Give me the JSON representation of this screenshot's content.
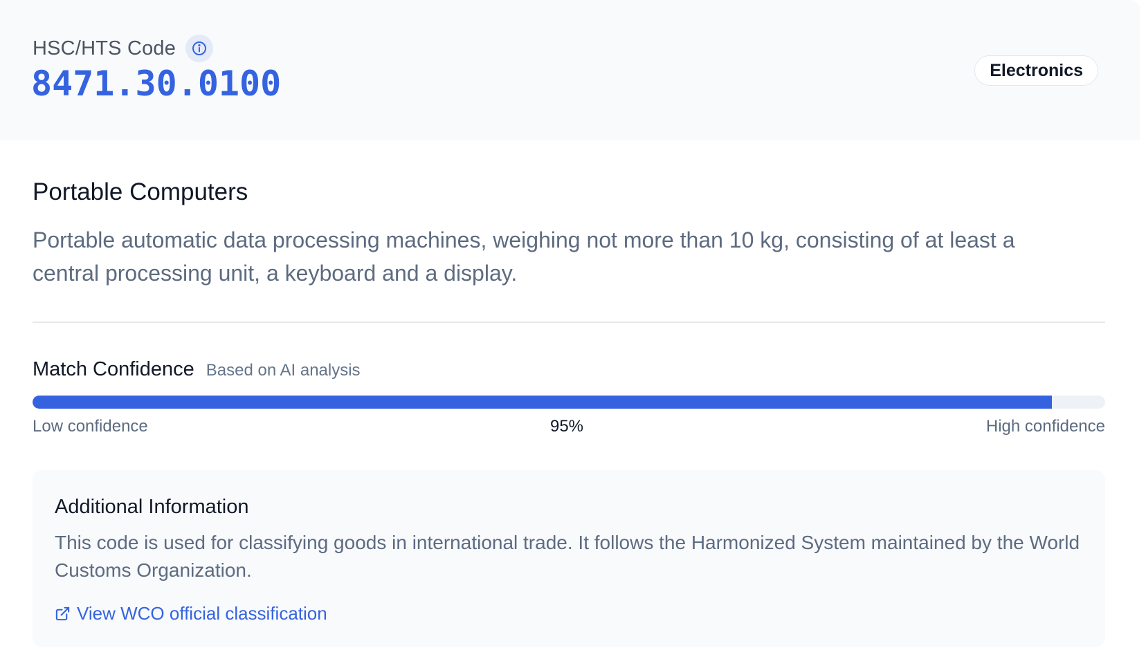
{
  "header": {
    "code_label": "HSC/HTS Code",
    "code_value": "8471.30.0100",
    "category": "Electronics",
    "info_icon": "info-circle-icon"
  },
  "product": {
    "title": "Portable Computers",
    "description": "Portable automatic data processing machines, weighing not more than 10 kg, consisting of at least a central processing unit, a keyboard and a display."
  },
  "confidence": {
    "title": "Match Confidence",
    "subtitle": "Based on AI analysis",
    "value_percent": 95,
    "value_label": "95%",
    "low_label": "Low confidence",
    "high_label": "High confidence"
  },
  "additional": {
    "title": "Additional Information",
    "text": "This code is used for classifying goods in international trade. It follows the Harmonized System maintained by the World Customs Organization.",
    "link_label": "View WCO official classification",
    "link_icon": "external-link-icon"
  },
  "colors": {
    "accent": "#3563e0",
    "muted_text": "#5d6b80",
    "panel_bg": "#f8fafc"
  }
}
